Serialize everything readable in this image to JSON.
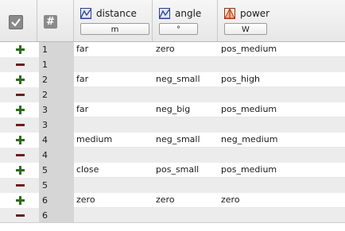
{
  "header": {
    "index_symbol": "#",
    "columns": [
      {
        "key": "distance",
        "title": "distance",
        "unit": "m",
        "icon": "input-variable-icon"
      },
      {
        "key": "angle",
        "title": "angle",
        "unit": "°",
        "icon": "input-variable-icon"
      },
      {
        "key": "power",
        "title": "power",
        "unit": "W",
        "icon": "output-variable-icon"
      }
    ]
  },
  "rules": [
    {
      "index": "1",
      "distance": "far",
      "angle": "zero",
      "power": "pos_medium"
    },
    {
      "index": "2",
      "distance": "far",
      "angle": "neg_small",
      "power": "pos_high"
    },
    {
      "index": "3",
      "distance": "far",
      "angle": "neg_big",
      "power": "pos_medium"
    },
    {
      "index": "4",
      "distance": "medium",
      "angle": "neg_small",
      "power": "neg_medium"
    },
    {
      "index": "5",
      "distance": "close",
      "angle": "pos_small",
      "power": "pos_medium"
    },
    {
      "index": "6",
      "distance": "zero",
      "angle": "zero",
      "power": "zero"
    }
  ],
  "colors": {
    "plus": "#2f6b1e",
    "minus": "#6b1e1e",
    "index_bg": "#d6d6d6",
    "separator_row": "#ececec"
  }
}
